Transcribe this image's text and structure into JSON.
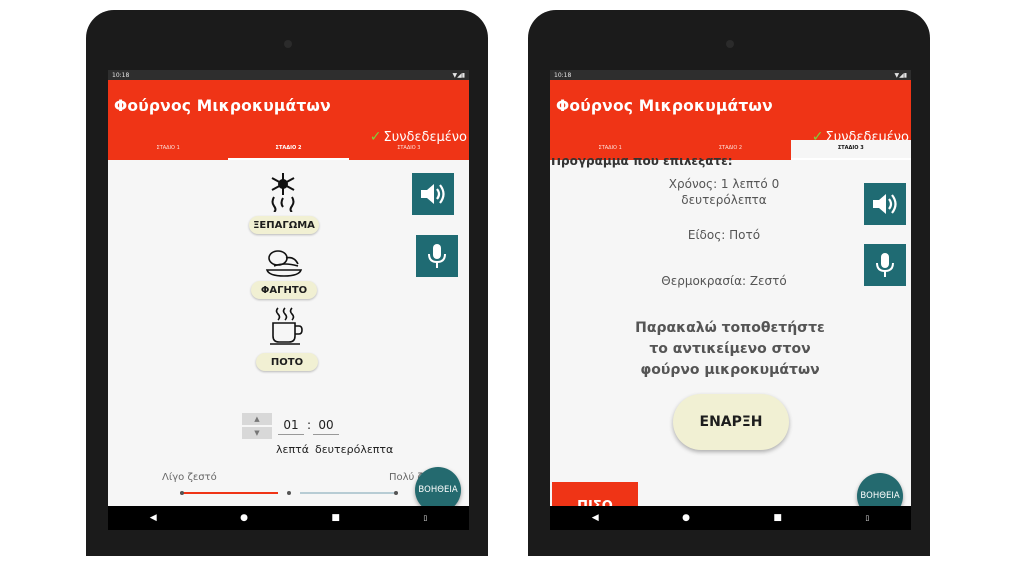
{
  "app": {
    "title": "Φούρνος Μικροκυμάτων",
    "connection_status": "Συνδεδεμένο",
    "connection_icon": "check-icon"
  },
  "colors": {
    "app_bar": "#ef3416",
    "action_teal": "#1f6b73",
    "pill_bg": "#f1f0d3",
    "connected_check": "#7fd13b"
  },
  "status_bar": {
    "time": "10:18"
  },
  "tabs": [
    "ΣΤΑΔΙΟ 1",
    "ΣΤΑΔΙΟ 2",
    "ΣΤΑΔΙΟ 3"
  ],
  "stage2": {
    "active_tab": "ΣΤΑΔΙΟ 2",
    "modes": [
      {
        "label": "ΞΕΠΑΓΩΜΑ",
        "icon": "defrost-icon"
      },
      {
        "label": "ΦΑΓΗΤΟ",
        "icon": "food-icon"
      },
      {
        "label": "ΠΟΤΟ",
        "icon": "drink-icon"
      }
    ],
    "timer": {
      "minutes": "01",
      "seconds": "00",
      "separator": ":",
      "minutes_label": "λεπτά",
      "seconds_label": "δευτερόλεπτα"
    },
    "temperature": {
      "low_label": "Λίγο ζεστό",
      "high_label": "Πολύ ζεστό",
      "level": 0.5
    },
    "help_label": "ΒΟΗΘΕΙΑ"
  },
  "stage3": {
    "active_tab": "ΣΤΑΔΙΟ 3",
    "heading": "Πρόγραμμα που επιλέξατε:",
    "time_line1": "Χρόνος: 1 λεπτό 0",
    "time_line2": "δευτερόλεπτα",
    "type": "Είδος: Ποτό",
    "temperature": "Θερμοκρασία: Ζεστό",
    "instruction_line1": "Παρακαλώ τοποθετήστε",
    "instruction_line2": "το αντικείμενο στον",
    "instruction_line3": "φούρνο μικροκυμάτων",
    "start_label": "ΕΝΑΡΞΗ",
    "back_label": "ΠΙΣΩ",
    "help_label": "ΒΟΗΘΕΙΑ"
  }
}
